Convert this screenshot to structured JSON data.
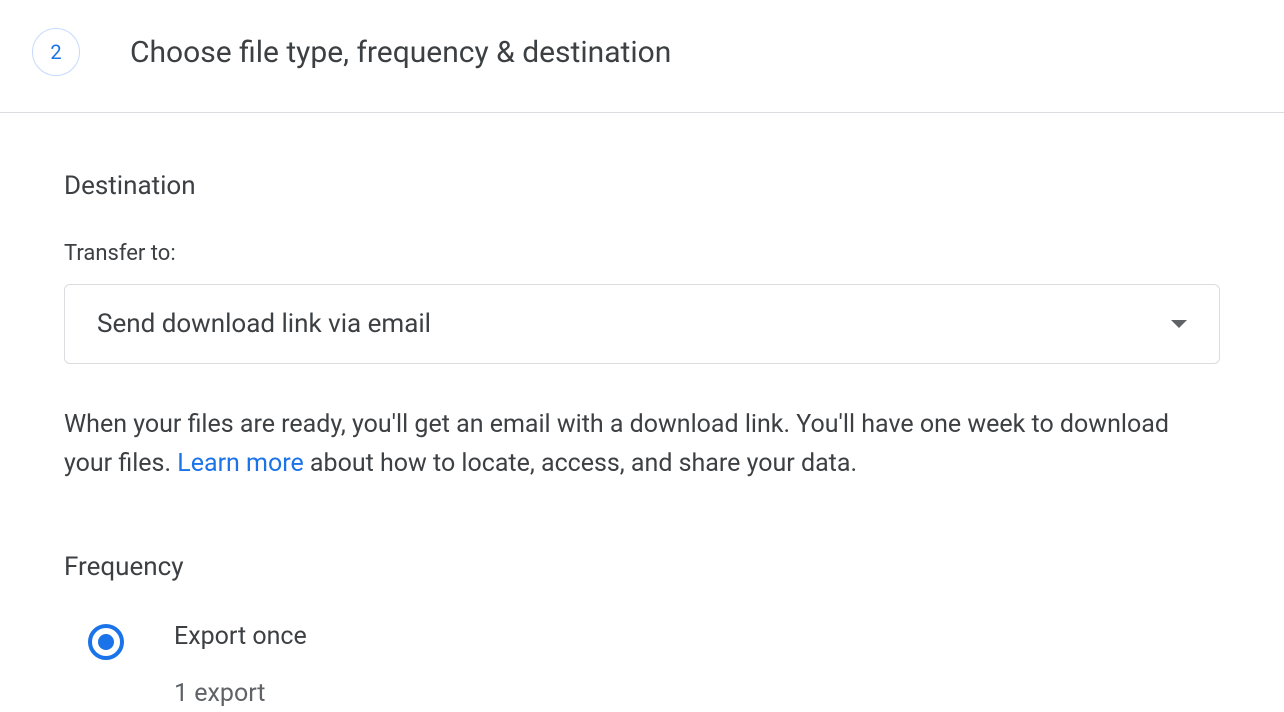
{
  "step": {
    "number": "2",
    "title": "Choose file type, frequency & destination"
  },
  "destination": {
    "heading": "Destination",
    "transfer_label": "Transfer to:",
    "selected": "Send download link via email",
    "description_part1": "When your files are ready, you'll get an email with a download link. You'll have one week to download your files. ",
    "learn_more": "Learn more",
    "description_part2": " about how to locate, access, and share your data."
  },
  "frequency": {
    "heading": "Frequency",
    "option1": {
      "label": "Export once",
      "sub": "1 export"
    }
  }
}
